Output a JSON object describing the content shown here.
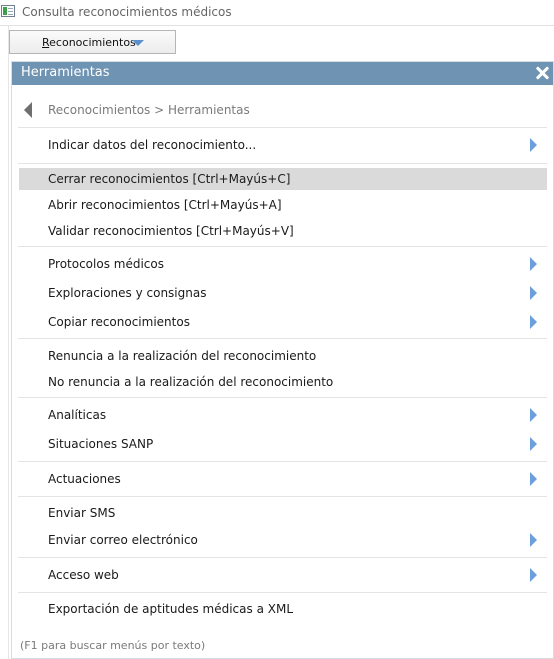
{
  "window": {
    "title": "Consulta reconocimientos médicos"
  },
  "toolbar": {
    "menu_button_label": "Reconocimientos"
  },
  "panel": {
    "title": "Herramientas",
    "breadcrumb": "Reconocimientos > Herramientas",
    "items": [
      {
        "label": "Indicar datos del reconocimiento..."
      },
      {
        "label": "Cerrar reconocimientos  [Ctrl+Mayús+C]"
      },
      {
        "label": "Abrir reconocimientos  [Ctrl+Mayús+A]"
      },
      {
        "label": "Validar reconocimientos  [Ctrl+Mayús+V]"
      },
      {
        "label": "Protocolos médicos"
      },
      {
        "label": "Exploraciones y consignas"
      },
      {
        "label": "Copiar reconocimientos"
      },
      {
        "label": "Renuncia a la realización del reconocimiento"
      },
      {
        "label": "No renuncia a la realización del reconocimiento"
      },
      {
        "label": "Analíticas"
      },
      {
        "label": "Situaciones SANP"
      },
      {
        "label": "Actuaciones"
      },
      {
        "label": "Enviar SMS"
      },
      {
        "label": "Enviar correo electrónico"
      },
      {
        "label": "Acceso web"
      },
      {
        "label": "Exportación de aptitudes médicas a XML"
      }
    ],
    "footer_hint": "(F1 para buscar menús por texto)"
  },
  "colors": {
    "header_bg": "#6f93b2",
    "highlight_bg": "#dadada",
    "submenu_arrow": "#6c9fdc",
    "dropdown_caret": "#5b8fd0"
  }
}
